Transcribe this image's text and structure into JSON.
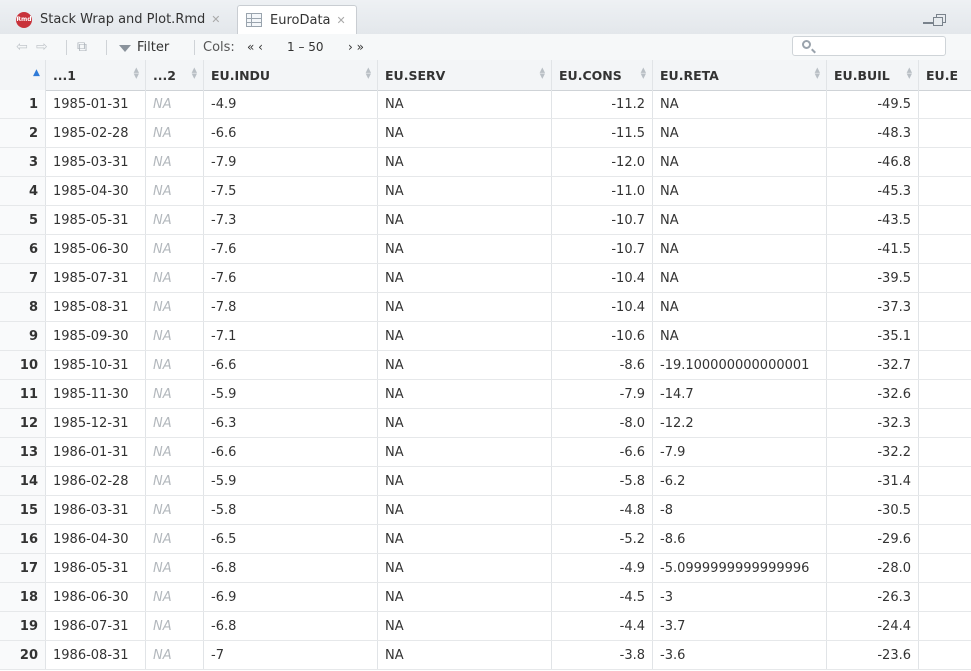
{
  "tabs": [
    {
      "label": "Stack Wrap and Plot.Rmd",
      "icon": "rmd-file-icon",
      "icon_text": "Rmd",
      "active": false
    },
    {
      "label": "EuroData",
      "icon": "data-grid-icon",
      "active": true
    }
  ],
  "toolbar": {
    "filter_label": "Filter",
    "cols_label": "Cols:",
    "cols_prev": "« ‹",
    "cols_range": "1 – 50",
    "cols_next": "› »",
    "search_placeholder": ""
  },
  "columns": [
    "",
    "...1",
    "...2",
    "EU.INDU",
    "EU.SERV",
    "EU.CONS",
    "EU.RETA",
    "EU.BUIL",
    "EU.E"
  ],
  "rows": [
    {
      "idx": "1",
      "c1": "1985-01-31",
      "c2": "NA",
      "indu": "-4.9",
      "serv": "NA",
      "cons": "-11.2",
      "reta": "NA",
      "buil": "-49.5"
    },
    {
      "idx": "2",
      "c1": "1985-02-28",
      "c2": "NA",
      "indu": "-6.6",
      "serv": "NA",
      "cons": "-11.5",
      "reta": "NA",
      "buil": "-48.3"
    },
    {
      "idx": "3",
      "c1": "1985-03-31",
      "c2": "NA",
      "indu": "-7.9",
      "serv": "NA",
      "cons": "-12.0",
      "reta": "NA",
      "buil": "-46.8"
    },
    {
      "idx": "4",
      "c1": "1985-04-30",
      "c2": "NA",
      "indu": "-7.5",
      "serv": "NA",
      "cons": "-11.0",
      "reta": "NA",
      "buil": "-45.3"
    },
    {
      "idx": "5",
      "c1": "1985-05-31",
      "c2": "NA",
      "indu": "-7.3",
      "serv": "NA",
      "cons": "-10.7",
      "reta": "NA",
      "buil": "-43.5"
    },
    {
      "idx": "6",
      "c1": "1985-06-30",
      "c2": "NA",
      "indu": "-7.6",
      "serv": "NA",
      "cons": "-10.7",
      "reta": "NA",
      "buil": "-41.5"
    },
    {
      "idx": "7",
      "c1": "1985-07-31",
      "c2": "NA",
      "indu": "-7.6",
      "serv": "NA",
      "cons": "-10.4",
      "reta": "NA",
      "buil": "-39.5"
    },
    {
      "idx": "8",
      "c1": "1985-08-31",
      "c2": "NA",
      "indu": "-7.8",
      "serv": "NA",
      "cons": "-10.4",
      "reta": "NA",
      "buil": "-37.3"
    },
    {
      "idx": "9",
      "c1": "1985-09-30",
      "c2": "NA",
      "indu": "-7.1",
      "serv": "NA",
      "cons": "-10.6",
      "reta": "NA",
      "buil": "-35.1"
    },
    {
      "idx": "10",
      "c1": "1985-10-31",
      "c2": "NA",
      "indu": "-6.6",
      "serv": "NA",
      "cons": "-8.6",
      "reta": "-19.100000000000001",
      "buil": "-32.7"
    },
    {
      "idx": "11",
      "c1": "1985-11-30",
      "c2": "NA",
      "indu": "-5.9",
      "serv": "NA",
      "cons": "-7.9",
      "reta": "-14.7",
      "buil": "-32.6"
    },
    {
      "idx": "12",
      "c1": "1985-12-31",
      "c2": "NA",
      "indu": "-6.3",
      "serv": "NA",
      "cons": "-8.0",
      "reta": "-12.2",
      "buil": "-32.3"
    },
    {
      "idx": "13",
      "c1": "1986-01-31",
      "c2": "NA",
      "indu": "-6.6",
      "serv": "NA",
      "cons": "-6.6",
      "reta": "-7.9",
      "buil": "-32.2"
    },
    {
      "idx": "14",
      "c1": "1986-02-28",
      "c2": "NA",
      "indu": "-5.9",
      "serv": "NA",
      "cons": "-5.8",
      "reta": "-6.2",
      "buil": "-31.4"
    },
    {
      "idx": "15",
      "c1": "1986-03-31",
      "c2": "NA",
      "indu": "-5.8",
      "serv": "NA",
      "cons": "-4.8",
      "reta": "-8",
      "buil": "-30.5"
    },
    {
      "idx": "16",
      "c1": "1986-04-30",
      "c2": "NA",
      "indu": "-6.5",
      "serv": "NA",
      "cons": "-5.2",
      "reta": "-8.6",
      "buil": "-29.6"
    },
    {
      "idx": "17",
      "c1": "1986-05-31",
      "c2": "NA",
      "indu": "-6.8",
      "serv": "NA",
      "cons": "-4.9",
      "reta": "-5.0999999999999996",
      "buil": "-28.0"
    },
    {
      "idx": "18",
      "c1": "1986-06-30",
      "c2": "NA",
      "indu": "-6.9",
      "serv": "NA",
      "cons": "-4.5",
      "reta": "-3",
      "buil": "-26.3"
    },
    {
      "idx": "19",
      "c1": "1986-07-31",
      "c2": "NA",
      "indu": "-6.8",
      "serv": "NA",
      "cons": "-4.4",
      "reta": "-3.7",
      "buil": "-24.4"
    },
    {
      "idx": "20",
      "c1": "1986-08-31",
      "c2": "NA",
      "indu": "-7",
      "serv": "NA",
      "cons": "-3.8",
      "reta": "-3.6",
      "buil": "-23.6"
    }
  ],
  "colors": {
    "na_text": "#b3b8bd",
    "sort_active": "#2f7bd8",
    "rmd_icon": "#c8323a"
  }
}
